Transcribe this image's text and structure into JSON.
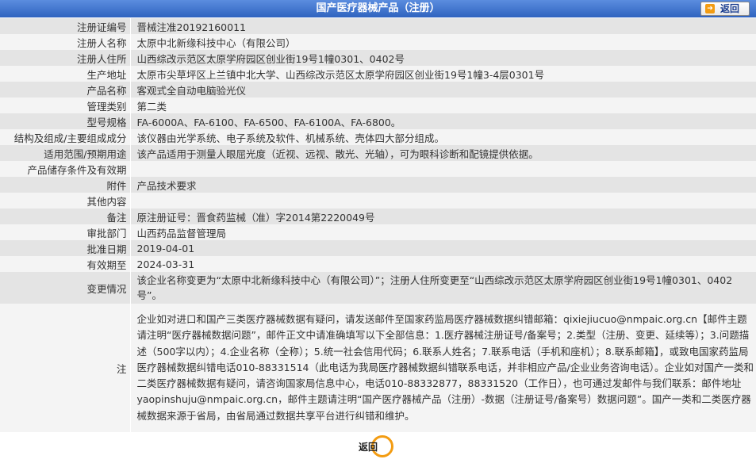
{
  "header": {
    "title": "国产医疗器械产品（注册）",
    "back_label": "返回"
  },
  "rows": [
    {
      "label": "注册证编号",
      "value": "晋械注准20192160011"
    },
    {
      "label": "注册人名称",
      "value": "太原中北新缘科技中心（有限公司）"
    },
    {
      "label": "注册人住所",
      "value": "山西综改示范区太原学府园区创业街19号1幢0301、0402号"
    },
    {
      "label": "生产地址",
      "value": "太原市尖草坪区上兰镇中北大学、山西综改示范区太原学府园区创业街19号1幢3-4层0301号"
    },
    {
      "label": "产品名称",
      "value": "客观式全自动电脑验光仪"
    },
    {
      "label": "管理类别",
      "value": "第二类"
    },
    {
      "label": "型号规格",
      "value": "FA-6000A、FA-6100、FA-6500、FA-6100A、FA-6800。"
    },
    {
      "label": "结构及组成/主要组成成分",
      "value": "该仪器由光学系统、电子系统及软件、机械系统、壳体四大部分组成。"
    },
    {
      "label": "适用范围/预期用途",
      "value": "该产品适用于测量人眼屈光度（近视、远视、散光、光轴），可为眼科诊断和配镜提供依据。"
    },
    {
      "label": "产品储存条件及有效期",
      "value": ""
    },
    {
      "label": "附件",
      "value": "产品技术要求"
    },
    {
      "label": "其他内容",
      "value": ""
    },
    {
      "label": "备注",
      "value": "原注册证号：晋食药监械（准）字2014第2220049号"
    },
    {
      "label": "审批部门",
      "value": "山西药品监督管理局"
    },
    {
      "label": "批准日期",
      "value": "2019-04-01"
    },
    {
      "label": "有效期至",
      "value": "2024-03-31"
    }
  ],
  "change": {
    "label": "变更情况",
    "value": "该企业名称变更为“太原中北新缘科技中心（有限公司）”；注册人住所变更至“山西综改示范区太原学府园区创业街19号1幢0301、0402号”。"
  },
  "note": {
    "label": "注",
    "text": "企业如对进口和国产三类医疗器械数据有疑问，请发送邮件至国家药监局医疗器械数据纠错邮箱：qixiejiucuo@nmpaic.org.cn【邮件主题请注明“医疗器械数据问题”，邮件正文中请准确填写以下全部信息：1.医疗器械注册证号/备案号；2.类型（注册、变更、延续等）；3.问题描述（500字以内）；4.企业名称（全称）；5.统一社会信用代码；6.联系人姓名；7.联系电话（手机和座机）；8.联系邮箱】，或致电国家药监局医疗器械数据纠错电话010-88331514（此电话为我局医疗器械数据纠错联系电话，并非相应产品/企业业务咨询电话）。企业如对国产一类和二类医疗器械数据有疑问，请咨询国家局信息中心，电话010-88332877，88331520（工作日），也可通过发邮件与我们联系：邮件地址yaopinshuju@nmpaic.org.cn，邮件主题请注明“国产医疗器械产品（注册）-数据（注册证号/备案号）数据问题”。国产一类和二类医疗器械数据来源于省局，由省局通过数据共享平台进行纠错和维护。"
  },
  "footer": {
    "back_label": "返回"
  }
}
